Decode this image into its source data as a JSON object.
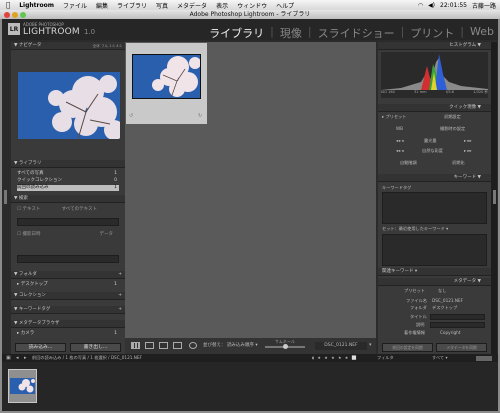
{
  "menubar": {
    "app_name": "Lightroom",
    "items": [
      "ファイル",
      "編集",
      "ライブラリ",
      "写真",
      "メタデータ",
      "表示",
      "ウィンドウ",
      "ヘルプ"
    ],
    "clock": "22:01:55",
    "user": "古藤一路"
  },
  "window": {
    "title": "Adobe Photoshop Lightroom - ライブラリ"
  },
  "brand": {
    "small": "ADOBE PHOTOSHOP",
    "big": "LIGHTROOM",
    "version": "1.0",
    "badge": "LR"
  },
  "modules": [
    "ライブラリ",
    "現像",
    "スライドショー",
    "プリント",
    "Web"
  ],
  "left": {
    "navigator": {
      "label": "ナビゲータ",
      "zoom_options": "全体  フル  1:1  4:1"
    },
    "library": {
      "label": "ライブラリ",
      "items": [
        {
          "label": "すべての写真",
          "count": "1"
        },
        {
          "label": "クイックコレクション",
          "count": "0"
        },
        {
          "label": "前回の読み込み",
          "count": "1"
        }
      ]
    },
    "find": {
      "label": "検索",
      "text_label": "テキスト",
      "text_value": "すべてのテキスト",
      "date_label": "撮影日時",
      "date_value": "データ"
    },
    "folders": {
      "label": "フォルダ",
      "item": "デスクトップ",
      "count": "1"
    },
    "collections": {
      "label": "コレクション"
    },
    "keyword_tags": {
      "label": "キーワードタグ"
    },
    "metadata_browser": {
      "label": "メタデータブラウザ",
      "item": "カメラ",
      "count": "1"
    },
    "import_button": "読み込み...",
    "export_button": "書き出し..."
  },
  "toolbar": {
    "sort_label": "並び替え",
    "sort_value": "読み込み順序",
    "thumb_label": "サムネール",
    "filename": "DSC_0121.NEF"
  },
  "right": {
    "histogram": {
      "label": "ヒストグラム",
      "info": [
        "ISO 160",
        "31 mm",
        "f/5.6",
        "1/320 秒"
      ]
    },
    "quick_develop": {
      "label": "クイック現像",
      "preset_label": "プリセット",
      "preset_value": "初期設定",
      "wb_label": "WB",
      "wb_value": "撮影時の設定",
      "exposure": "露光量",
      "fill": "自然な彩度",
      "auto_tone": "自動階調",
      "reset": "初期化"
    },
    "keywording": {
      "label": "キーワード",
      "tag_label": "キーワードタグ",
      "recent_label": "セット：最近使用したキーワード"
    },
    "keyword_list": {
      "label": "関連キーワード"
    },
    "metadata": {
      "label": "メタデータ",
      "preset_label": "プリセット",
      "preset_value": "なし",
      "filename_label": "ファイル名",
      "filename_value": "DSC_0121.NEF",
      "folder_label": "フォルダ",
      "folder_value": "デスクトップ",
      "title_label": "タイトル",
      "caption_label": "説明",
      "copyright_label": "著作権情報",
      "copyright_value": "Copyright"
    },
    "sync_button": "前回の設定を同期",
    "sync_settings_button": "メタデータを同期"
  },
  "bottom": {
    "status": "前回の読み込み / 1 枚の写真 / 1 枚選択 / DSC_0121.NEF",
    "filter_label": "フィルタ",
    "filter_value": "すべて"
  },
  "colors": {
    "sky": "#2a5fae",
    "panel": "#3a3a3a",
    "center": "#5a5a5a",
    "active_module": "#f2f2f2"
  }
}
